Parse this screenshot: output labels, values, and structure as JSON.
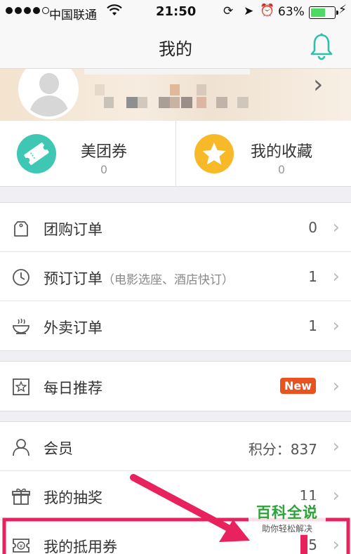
{
  "status_bar": {
    "carrier": "中国联通",
    "time": "21:50",
    "battery_percent": "63%",
    "battery_level": 0.63
  },
  "nav": {
    "title": "我的",
    "bell_icon": "bell-icon"
  },
  "quick": {
    "coupon": {
      "label": "美团券",
      "count": "0",
      "icon": "ticket-icon",
      "color": "#3ec7b2"
    },
    "favorites": {
      "label": "我的收藏",
      "count": "0",
      "icon": "star-icon",
      "color": "#f8b928"
    }
  },
  "orders": [
    {
      "label": "团购订单",
      "sub": "",
      "value": "0",
      "icon": "tag-icon"
    },
    {
      "label": "预订订单",
      "sub": "（电影选座、酒店快订）",
      "value": "1",
      "icon": "clock-icon"
    },
    {
      "label": "外卖订单",
      "sub": "",
      "value": "1",
      "icon": "bowl-icon"
    }
  ],
  "daily": {
    "label": "每日推荐",
    "badge": "New",
    "icon": "star-box-icon"
  },
  "member": [
    {
      "label": "会员",
      "value": "积分：837",
      "icon": "person-icon"
    },
    {
      "label": "我的抽奖",
      "value": "11",
      "icon": "gift-icon"
    },
    {
      "label": "我的抵用券",
      "value": "5",
      "icon": "voucher-icon"
    }
  ],
  "watermark": {
    "title": "百科全说",
    "subtitle": "助你轻松解决"
  },
  "colors": {
    "accent": "#3ec7b2",
    "highlight": "#e8225c",
    "new_badge": "#e8531f"
  }
}
